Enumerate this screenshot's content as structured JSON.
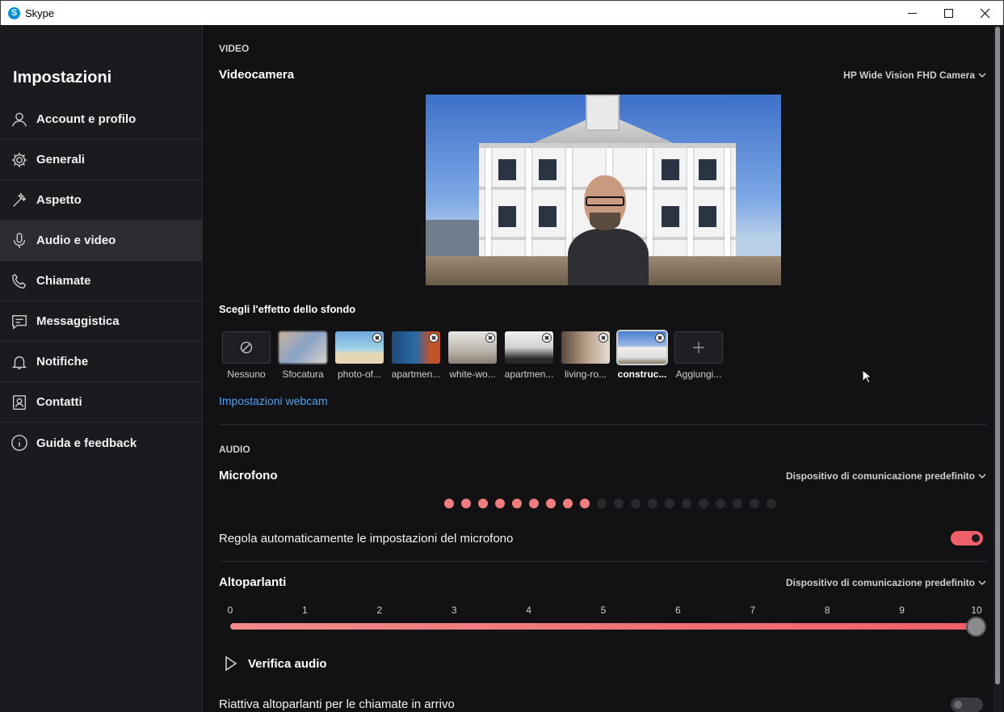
{
  "window": {
    "title": "Skype"
  },
  "sidebar": {
    "heading": "Impostazioni",
    "items": [
      {
        "label": "Account e profilo",
        "icon": "person-icon"
      },
      {
        "label": "Generali",
        "icon": "gear-icon"
      },
      {
        "label": "Aspetto",
        "icon": "magic-wand-icon"
      },
      {
        "label": "Audio e video",
        "icon": "microphone-icon",
        "active": true
      },
      {
        "label": "Chiamate",
        "icon": "phone-icon"
      },
      {
        "label": "Messaggistica",
        "icon": "chat-icon"
      },
      {
        "label": "Notifiche",
        "icon": "bell-icon"
      },
      {
        "label": "Contatti",
        "icon": "contacts-icon"
      },
      {
        "label": "Guida e feedback",
        "icon": "info-icon"
      }
    ]
  },
  "video": {
    "section": "VIDEO",
    "camera_label": "Videocamera",
    "camera_device": "HP Wide Vision FHD Camera",
    "background_title": "Scegli l'effetto dello sfondo",
    "backgrounds": [
      {
        "caption": "Nessuno"
      },
      {
        "caption": "Sfocatura"
      },
      {
        "caption": "photo-of..."
      },
      {
        "caption": "apartmen..."
      },
      {
        "caption": "white-wo..."
      },
      {
        "caption": "apartmen..."
      },
      {
        "caption": "living-ro..."
      },
      {
        "caption": "construc...",
        "selected": true
      },
      {
        "caption": "Aggiungi..."
      }
    ],
    "webcam_link": "Impostazioni webcam"
  },
  "audio": {
    "section": "AUDIO",
    "mic_label": "Microfono",
    "mic_device": "Dispositivo di comunicazione predefinito",
    "mic_level": 0.45,
    "auto_adjust_label": "Regola automaticamente le impostazioni del microfono",
    "auto_adjust_on": true,
    "speakers_label": "Altoparlanti",
    "speakers_device": "Dispositivo di comunicazione predefinito",
    "volume_scale": [
      "0",
      "1",
      "2",
      "3",
      "4",
      "5",
      "6",
      "7",
      "8",
      "9",
      "10"
    ],
    "volume_value": 10,
    "test_audio_label": "Verifica audio",
    "unmute_label": "Riattiva altoparlanti per le chiamate in arrivo",
    "unmute_on": false
  },
  "colors": {
    "accent": "#ef5f6a",
    "link": "#4ea1f3",
    "background": "#121214",
    "sidebar": "#1b1b1f"
  }
}
